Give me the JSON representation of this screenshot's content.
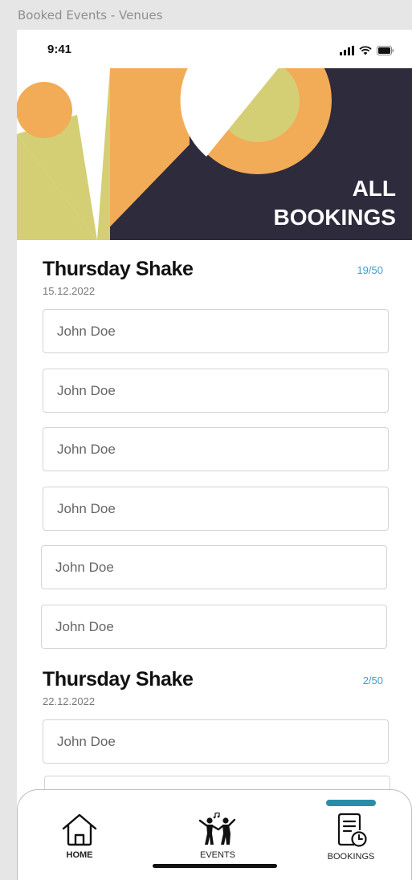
{
  "frame_label": "Booked Events - Venues",
  "status_bar": {
    "time": "9:41"
  },
  "banner": {
    "line1": "ALL",
    "line2": "BOOKINGS"
  },
  "events": [
    {
      "title": "Thursday Shake",
      "date": "15.12.2022",
      "count": "19/50",
      "attendees": [
        "John Doe",
        "John Doe",
        "John Doe",
        "John Doe",
        "John Doe",
        "John Doe"
      ]
    },
    {
      "title": "Thursday Shake",
      "date": "22.12.2022",
      "count": "2/50",
      "attendees": [
        "John Doe",
        ""
      ]
    }
  ],
  "tabbar": {
    "home": "HOME",
    "events": "EVENTS",
    "bookings": "BOOKINGS",
    "active": "bookings"
  },
  "colors": {
    "banner_bg": "#2e2b3c",
    "orange": "#f2ac57",
    "olive": "#d4cf74",
    "accent": "#3a9fd0",
    "tab_indicator": "#2b8caa"
  }
}
